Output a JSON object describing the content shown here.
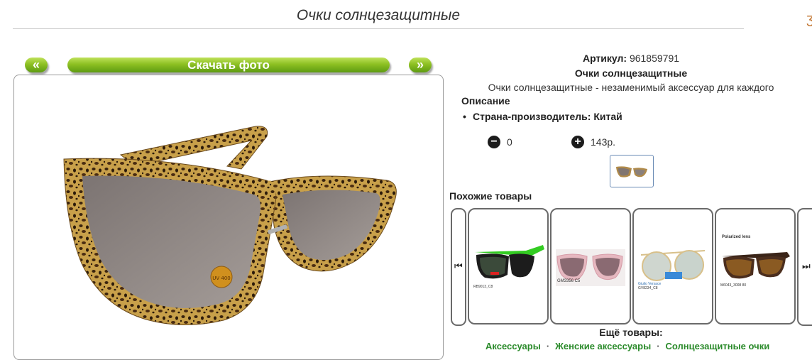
{
  "page": {
    "title": "Очки солнцезащитные"
  },
  "gallery": {
    "prev_label": "«",
    "download_label": "Скачать фото",
    "next_label": "»",
    "lens_badge": "UV 400"
  },
  "product": {
    "article_label": "Артикул:",
    "article_value": "961859791",
    "name": "Очки солнцезащитные",
    "short_description": "Очки солнцезащитные - незаменимый аксессуар для каждого",
    "description_heading": "Описание",
    "specs": [
      {
        "label": "Страна-производитель:",
        "value": "Китай"
      }
    ]
  },
  "cart": {
    "quantity": "0",
    "price": "143р.",
    "minus_icon": "minus-circle-icon",
    "plus_icon": "plus-circle-icon"
  },
  "similar": {
    "title": "Похожие товары",
    "prev_icon": "skip-back-icon",
    "next_icon": "skip-forward-icon",
    "items": [
      {
        "code": "RB9013_C8"
      },
      {
        "code": "GM3356 C5"
      },
      {
        "code": "GV8234_C8",
        "brand": "Giulio Versace"
      },
      {
        "code": "M6043_3008 80",
        "tag": "Polarized lens"
      }
    ]
  },
  "more": {
    "title": "Ещё товары:",
    "links": [
      "Аксессуары",
      "Женские аксессуары",
      "Солнцезащитные очки"
    ]
  },
  "colors": {
    "accent_green": "#8dc022",
    "link_green": "#2a8a2a",
    "leopard_base": "#c8a04a"
  }
}
